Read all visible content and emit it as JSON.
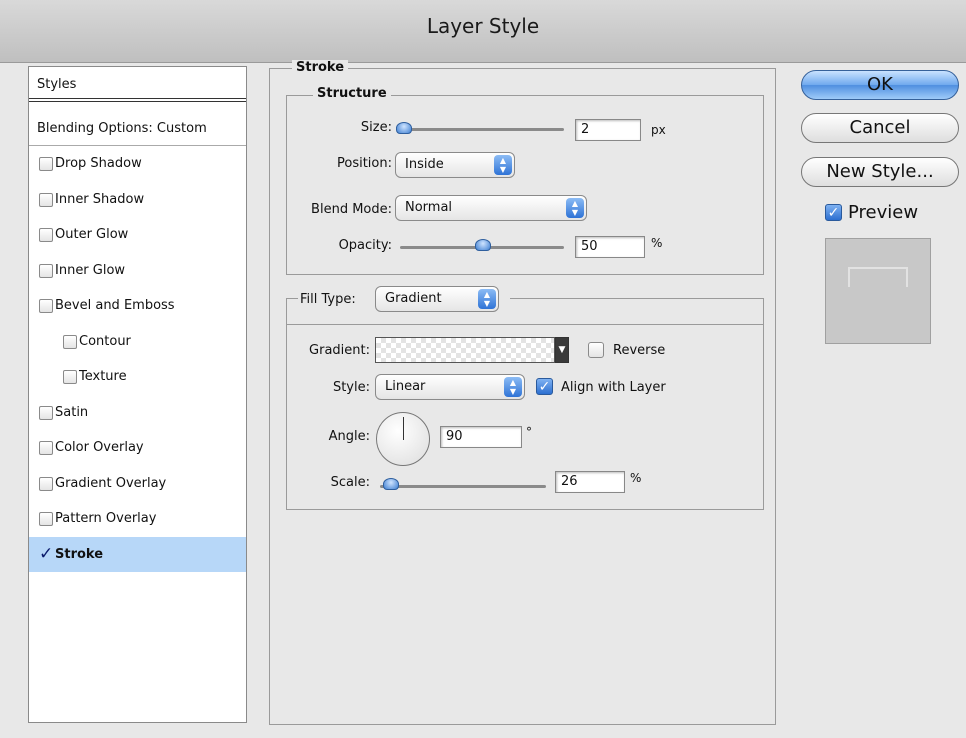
{
  "window": {
    "title": "Layer Style"
  },
  "styles_panel": {
    "header": "Styles",
    "blending_options": "Blending Options: Custom",
    "items": [
      {
        "label": "Drop Shadow",
        "checked": false,
        "indent": false
      },
      {
        "label": "Inner Shadow",
        "checked": false,
        "indent": false
      },
      {
        "label": "Outer Glow",
        "checked": false,
        "indent": false
      },
      {
        "label": "Inner Glow",
        "checked": false,
        "indent": false
      },
      {
        "label": "Bevel and Emboss",
        "checked": false,
        "indent": false
      },
      {
        "label": "Contour",
        "checked": false,
        "indent": true
      },
      {
        "label": "Texture",
        "checked": false,
        "indent": true
      },
      {
        "label": "Satin",
        "checked": false,
        "indent": false
      },
      {
        "label": "Color Overlay",
        "checked": false,
        "indent": false
      },
      {
        "label": "Gradient Overlay",
        "checked": false,
        "indent": false
      },
      {
        "label": "Pattern Overlay",
        "checked": false,
        "indent": false
      },
      {
        "label": "Stroke",
        "checked": true,
        "selected": true,
        "indent": false
      }
    ]
  },
  "stroke": {
    "legend": "Stroke",
    "structure": {
      "legend": "Structure",
      "size_label": "Size:",
      "size_value": "2",
      "size_unit": "px",
      "size_slider": 0.02,
      "position_label": "Position:",
      "position_value": "Inside",
      "blend_mode_label": "Blend Mode:",
      "blend_mode_value": "Normal",
      "opacity_label": "Opacity:",
      "opacity_value": "50",
      "opacity_unit": "%",
      "opacity_slider": 0.5
    },
    "fill_type": {
      "label": "Fill Type:",
      "value": "Gradient",
      "gradient_label": "Gradient:",
      "reverse_label": "Reverse",
      "reverse_checked": false,
      "style_label": "Style:",
      "style_value": "Linear",
      "align_label": "Align with Layer",
      "align_checked": true,
      "angle_label": "Angle:",
      "angle_value": "90",
      "angle_unit": "°",
      "scale_label": "Scale:",
      "scale_value": "26",
      "scale_unit": "%",
      "scale_slider": 0.06
    }
  },
  "buttons": {
    "ok": "OK",
    "cancel": "Cancel",
    "new_style": "New Style...",
    "preview_label": "Preview",
    "preview_checked": true
  },
  "icons": {
    "checkmark": "checkmark-icon",
    "select_arrows": "up-down-arrows-icon",
    "dropdown": "triangle-down-icon"
  },
  "colors": {
    "selected_row": "#b7d7f8",
    "accent_blue": "#4f8fe0"
  }
}
